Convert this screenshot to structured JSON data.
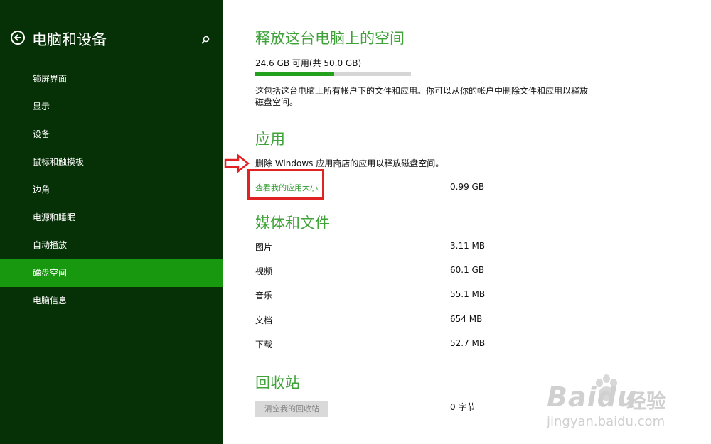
{
  "sidebar": {
    "title": "电脑和设备",
    "items": [
      {
        "label": "锁屏界面"
      },
      {
        "label": "显示"
      },
      {
        "label": "设备"
      },
      {
        "label": "鼠标和触摸板"
      },
      {
        "label": "边角"
      },
      {
        "label": "电源和睡眠"
      },
      {
        "label": "自动播放"
      },
      {
        "label": "磁盘空间"
      },
      {
        "label": "电脑信息"
      }
    ],
    "active_label": "磁盘空间"
  },
  "main": {
    "title": "释放这台电脑上的空间",
    "storage": {
      "text": "24.6 GB 可用(共 50.0 GB)",
      "used_fraction": 0.508
    },
    "description": "这包括这台电脑上所有帐户下的文件和应用。你可以从你的帐户中删除文件和应用以释放磁盘空间。",
    "apps": {
      "title": "应用",
      "description": "删除 Windows 应用商店的应用以释放磁盘空间。",
      "link": "查看我的应用大小",
      "size": "0.99 GB"
    },
    "media": {
      "title": "媒体和文件",
      "rows": [
        {
          "label": "图片",
          "value": "3.11 MB"
        },
        {
          "label": "视频",
          "value": "60.1 GB"
        },
        {
          "label": "音乐",
          "value": "55.1 MB"
        },
        {
          "label": "文档",
          "value": "654 MB"
        },
        {
          "label": "下载",
          "value": "52.7 MB"
        }
      ]
    },
    "recycle": {
      "title": "回收站",
      "button": "清空我的回收站",
      "size": "0 字节"
    }
  },
  "watermark": {
    "brand": "Bai",
    "brand_suffix": "du",
    "brand2": "经验",
    "url": "jingyan.baidu.com"
  },
  "colors": {
    "sidebar_bg": "#063006",
    "active": "#18980e",
    "accent": "#3fa33a",
    "highlight": "#e02222"
  }
}
